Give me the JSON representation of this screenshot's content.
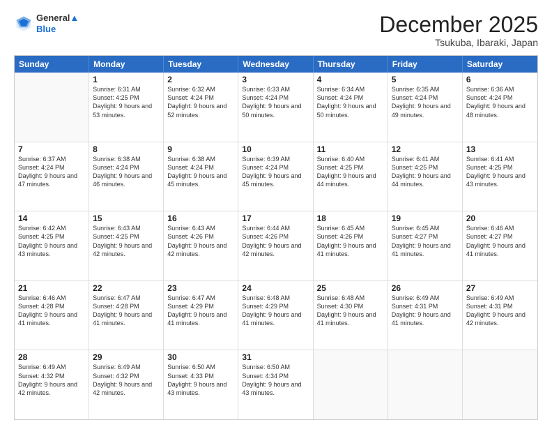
{
  "header": {
    "logo_line1": "General",
    "logo_line2": "Blue",
    "month": "December 2025",
    "location": "Tsukuba, Ibaraki, Japan"
  },
  "days_of_week": [
    "Sunday",
    "Monday",
    "Tuesday",
    "Wednesday",
    "Thursday",
    "Friday",
    "Saturday"
  ],
  "weeks": [
    [
      {
        "day": "",
        "sunrise": "",
        "sunset": "",
        "daylight": ""
      },
      {
        "day": "1",
        "sunrise": "Sunrise: 6:31 AM",
        "sunset": "Sunset: 4:25 PM",
        "daylight": "Daylight: 9 hours and 53 minutes."
      },
      {
        "day": "2",
        "sunrise": "Sunrise: 6:32 AM",
        "sunset": "Sunset: 4:24 PM",
        "daylight": "Daylight: 9 hours and 52 minutes."
      },
      {
        "day": "3",
        "sunrise": "Sunrise: 6:33 AM",
        "sunset": "Sunset: 4:24 PM",
        "daylight": "Daylight: 9 hours and 50 minutes."
      },
      {
        "day": "4",
        "sunrise": "Sunrise: 6:34 AM",
        "sunset": "Sunset: 4:24 PM",
        "daylight": "Daylight: 9 hours and 50 minutes."
      },
      {
        "day": "5",
        "sunrise": "Sunrise: 6:35 AM",
        "sunset": "Sunset: 4:24 PM",
        "daylight": "Daylight: 9 hours and 49 minutes."
      },
      {
        "day": "6",
        "sunrise": "Sunrise: 6:36 AM",
        "sunset": "Sunset: 4:24 PM",
        "daylight": "Daylight: 9 hours and 48 minutes."
      }
    ],
    [
      {
        "day": "7",
        "sunrise": "Sunrise: 6:37 AM",
        "sunset": "Sunset: 4:24 PM",
        "daylight": "Daylight: 9 hours and 47 minutes."
      },
      {
        "day": "8",
        "sunrise": "Sunrise: 6:38 AM",
        "sunset": "Sunset: 4:24 PM",
        "daylight": "Daylight: 9 hours and 46 minutes."
      },
      {
        "day": "9",
        "sunrise": "Sunrise: 6:38 AM",
        "sunset": "Sunset: 4:24 PM",
        "daylight": "Daylight: 9 hours and 45 minutes."
      },
      {
        "day": "10",
        "sunrise": "Sunrise: 6:39 AM",
        "sunset": "Sunset: 4:24 PM",
        "daylight": "Daylight: 9 hours and 45 minutes."
      },
      {
        "day": "11",
        "sunrise": "Sunrise: 6:40 AM",
        "sunset": "Sunset: 4:25 PM",
        "daylight": "Daylight: 9 hours and 44 minutes."
      },
      {
        "day": "12",
        "sunrise": "Sunrise: 6:41 AM",
        "sunset": "Sunset: 4:25 PM",
        "daylight": "Daylight: 9 hours and 44 minutes."
      },
      {
        "day": "13",
        "sunrise": "Sunrise: 6:41 AM",
        "sunset": "Sunset: 4:25 PM",
        "daylight": "Daylight: 9 hours and 43 minutes."
      }
    ],
    [
      {
        "day": "14",
        "sunrise": "Sunrise: 6:42 AM",
        "sunset": "Sunset: 4:25 PM",
        "daylight": "Daylight: 9 hours and 43 minutes."
      },
      {
        "day": "15",
        "sunrise": "Sunrise: 6:43 AM",
        "sunset": "Sunset: 4:25 PM",
        "daylight": "Daylight: 9 hours and 42 minutes."
      },
      {
        "day": "16",
        "sunrise": "Sunrise: 6:43 AM",
        "sunset": "Sunset: 4:26 PM",
        "daylight": "Daylight: 9 hours and 42 minutes."
      },
      {
        "day": "17",
        "sunrise": "Sunrise: 6:44 AM",
        "sunset": "Sunset: 4:26 PM",
        "daylight": "Daylight: 9 hours and 42 minutes."
      },
      {
        "day": "18",
        "sunrise": "Sunrise: 6:45 AM",
        "sunset": "Sunset: 4:26 PM",
        "daylight": "Daylight: 9 hours and 41 minutes."
      },
      {
        "day": "19",
        "sunrise": "Sunrise: 6:45 AM",
        "sunset": "Sunset: 4:27 PM",
        "daylight": "Daylight: 9 hours and 41 minutes."
      },
      {
        "day": "20",
        "sunrise": "Sunrise: 6:46 AM",
        "sunset": "Sunset: 4:27 PM",
        "daylight": "Daylight: 9 hours and 41 minutes."
      }
    ],
    [
      {
        "day": "21",
        "sunrise": "Sunrise: 6:46 AM",
        "sunset": "Sunset: 4:28 PM",
        "daylight": "Daylight: 9 hours and 41 minutes."
      },
      {
        "day": "22",
        "sunrise": "Sunrise: 6:47 AM",
        "sunset": "Sunset: 4:28 PM",
        "daylight": "Daylight: 9 hours and 41 minutes."
      },
      {
        "day": "23",
        "sunrise": "Sunrise: 6:47 AM",
        "sunset": "Sunset: 4:29 PM",
        "daylight": "Daylight: 9 hours and 41 minutes."
      },
      {
        "day": "24",
        "sunrise": "Sunrise: 6:48 AM",
        "sunset": "Sunset: 4:29 PM",
        "daylight": "Daylight: 9 hours and 41 minutes."
      },
      {
        "day": "25",
        "sunrise": "Sunrise: 6:48 AM",
        "sunset": "Sunset: 4:30 PM",
        "daylight": "Daylight: 9 hours and 41 minutes."
      },
      {
        "day": "26",
        "sunrise": "Sunrise: 6:49 AM",
        "sunset": "Sunset: 4:31 PM",
        "daylight": "Daylight: 9 hours and 41 minutes."
      },
      {
        "day": "27",
        "sunrise": "Sunrise: 6:49 AM",
        "sunset": "Sunset: 4:31 PM",
        "daylight": "Daylight: 9 hours and 42 minutes."
      }
    ],
    [
      {
        "day": "28",
        "sunrise": "Sunrise: 6:49 AM",
        "sunset": "Sunset: 4:32 PM",
        "daylight": "Daylight: 9 hours and 42 minutes."
      },
      {
        "day": "29",
        "sunrise": "Sunrise: 6:49 AM",
        "sunset": "Sunset: 4:32 PM",
        "daylight": "Daylight: 9 hours and 42 minutes."
      },
      {
        "day": "30",
        "sunrise": "Sunrise: 6:50 AM",
        "sunset": "Sunset: 4:33 PM",
        "daylight": "Daylight: 9 hours and 43 minutes."
      },
      {
        "day": "31",
        "sunrise": "Sunrise: 6:50 AM",
        "sunset": "Sunset: 4:34 PM",
        "daylight": "Daylight: 9 hours and 43 minutes."
      },
      {
        "day": "",
        "sunrise": "",
        "sunset": "",
        "daylight": ""
      },
      {
        "day": "",
        "sunrise": "",
        "sunset": "",
        "daylight": ""
      },
      {
        "day": "",
        "sunrise": "",
        "sunset": "",
        "daylight": ""
      }
    ]
  ]
}
